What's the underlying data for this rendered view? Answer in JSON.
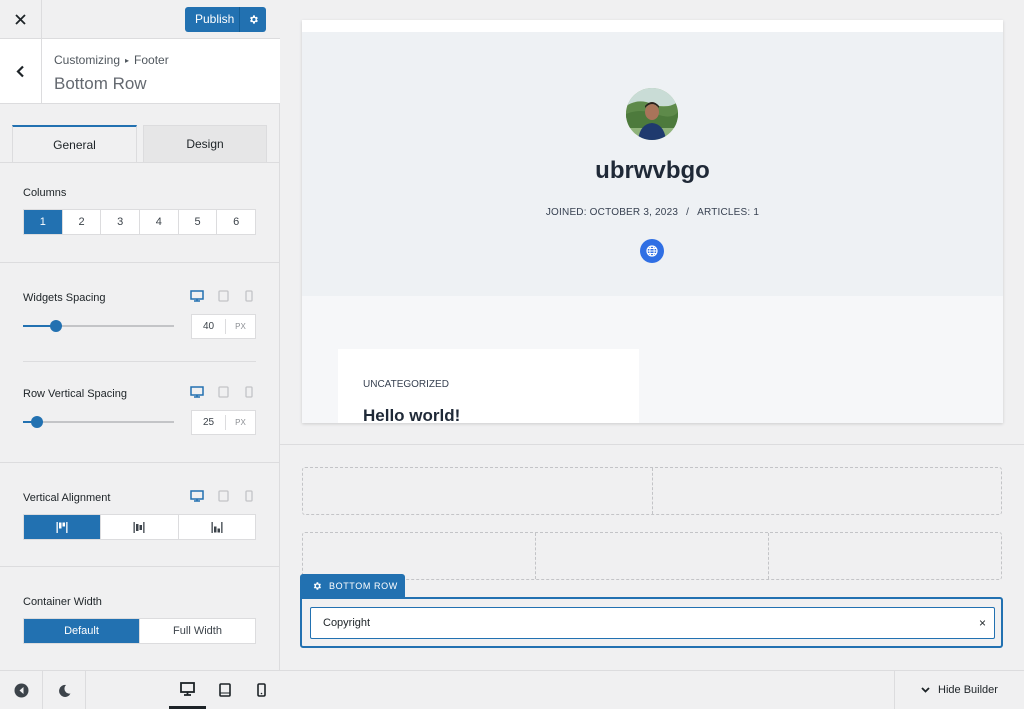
{
  "topbar": {
    "close_icon": "close-icon",
    "publish_label": "Publish",
    "publish_gear_icon": "gear-icon"
  },
  "section": {
    "breadcrumb_parent": "Customizing",
    "breadcrumb_child": "Footer",
    "title": "Bottom Row"
  },
  "tabs": [
    {
      "label": "General",
      "active": true
    },
    {
      "label": "Design",
      "active": false
    }
  ],
  "columns": {
    "label": "Columns",
    "options": [
      "1",
      "2",
      "3",
      "4",
      "5",
      "6"
    ],
    "selected": "1"
  },
  "widgets_spacing": {
    "label": "Widgets Spacing",
    "value": "40",
    "unit": "PX",
    "slider_fraction": 0.22
  },
  "row_vertical_spacing": {
    "label": "Row Vertical Spacing",
    "value": "25",
    "unit": "PX",
    "slider_fraction": 0.09
  },
  "vertical_alignment": {
    "label": "Vertical Alignment",
    "options": [
      "align-top-icon",
      "align-middle-icon",
      "align-bottom-icon"
    ],
    "selected": 0
  },
  "container_width": {
    "label": "Container Width",
    "options": [
      "Default",
      "Full Width"
    ],
    "selected": "Default"
  },
  "bottom_bar": {
    "icons": [
      "back-circle-icon",
      "dark-mode-icon",
      "desktop-icon",
      "tablet-icon",
      "mobile-icon"
    ],
    "active_device": "desktop"
  },
  "preview": {
    "author_name": "ubrwvbgo",
    "joined": "JOINED: OCTOBER 3, 2023",
    "separator": "/",
    "articles": "ARTICLES: 1",
    "post_category": "UNCATEGORIZED",
    "post_title": "Hello world!"
  },
  "builder": {
    "bottom_row_tab": "BOTTOM ROW",
    "copyright_item": "Copyright",
    "remove_symbol": "×",
    "hide_builder": "Hide Builder"
  },
  "colors": {
    "accent": "#2271b1",
    "web_button": "#2f6fe4",
    "hero_bg": "#eef1f4"
  }
}
